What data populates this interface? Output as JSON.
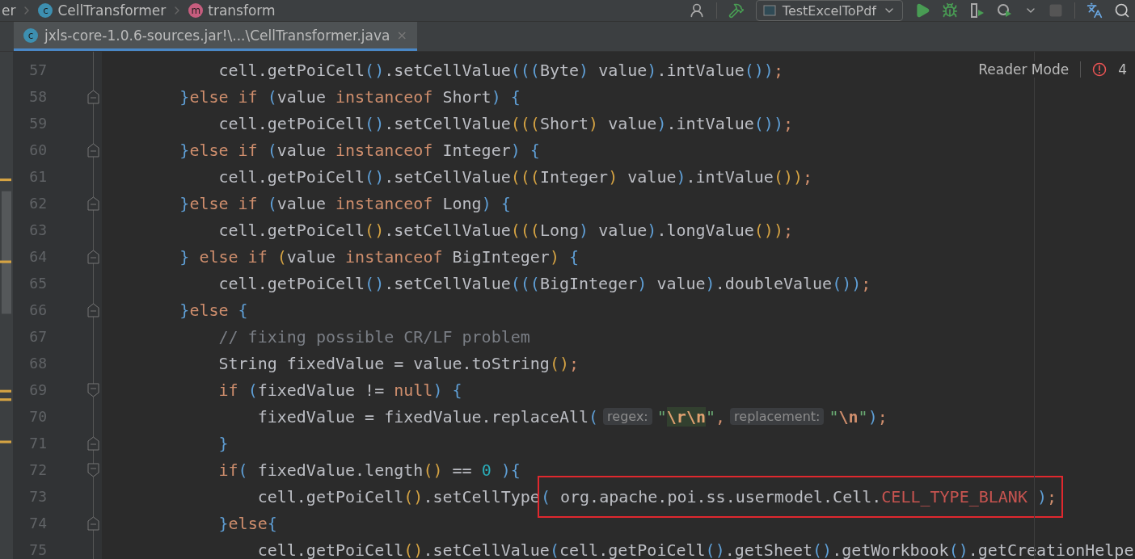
{
  "breadcrumb": [
    {
      "label": "er"
    },
    {
      "label": "CellTransformer",
      "kind": "class",
      "icon_letter": "c"
    },
    {
      "label": "transform",
      "kind": "method",
      "icon_letter": "m"
    }
  ],
  "toolbar": {
    "run_configuration": "TestExcelToPdf"
  },
  "tabs": [
    {
      "label": "jxls-core-1.0.6-sources.jar!\\...\\CellTransformer.java",
      "icon_letter": "c",
      "close": "×",
      "selected": true
    }
  ],
  "editor": {
    "reader_mode": "Reader Mode",
    "error_count": "4",
    "lines": [
      {
        "n": "57",
        "kind": "code",
        "tokens": [
          {
            "t": "            cell.getPoiCell",
            "kind": "plain"
          },
          {
            "t": "()",
            "kind": "paren"
          },
          {
            "t": ".setCellValue",
            "kind": "plain"
          },
          {
            "t": "(((",
            "kind": "paren"
          },
          {
            "t": "Byte",
            "kind": "plain"
          },
          {
            "t": ")",
            "kind": "paren"
          },
          {
            "t": " value",
            "kind": "plain"
          },
          {
            "t": ")",
            "kind": "paren"
          },
          {
            "t": ".intValue",
            "kind": "plain"
          },
          {
            "t": "())",
            "kind": "paren"
          },
          {
            "t": ";",
            "kind": "keyword"
          }
        ]
      },
      {
        "n": "58",
        "kind": "fold-end",
        "tokens": [
          {
            "t": "        }",
            "kind": "paren"
          },
          {
            "t": "else if ",
            "kind": "keyword"
          },
          {
            "t": "(",
            "kind": "paren"
          },
          {
            "t": "value ",
            "kind": "plain"
          },
          {
            "t": "instanceof ",
            "kind": "keyword"
          },
          {
            "t": "Short",
            "kind": "plain"
          },
          {
            "t": ") {",
            "kind": "paren"
          }
        ]
      },
      {
        "n": "59",
        "kind": "code",
        "tokens": [
          {
            "t": "            cell.getPoiCell",
            "kind": "plain"
          },
          {
            "t": "()",
            "kind": "paren"
          },
          {
            "t": ".setCellValue",
            "kind": "plain"
          },
          {
            "t": "(((",
            "kind": "paren2"
          },
          {
            "t": "Short",
            "kind": "plain"
          },
          {
            "t": ")",
            "kind": "paren2"
          },
          {
            "t": " value",
            "kind": "plain"
          },
          {
            "t": ")",
            "kind": "paren"
          },
          {
            "t": ".intValue",
            "kind": "plain"
          },
          {
            "t": "())",
            "kind": "paren"
          },
          {
            "t": ";",
            "kind": "keyword"
          }
        ]
      },
      {
        "n": "60",
        "kind": "fold-end",
        "tokens": [
          {
            "t": "        }",
            "kind": "paren"
          },
          {
            "t": "else if ",
            "kind": "keyword"
          },
          {
            "t": "(",
            "kind": "paren"
          },
          {
            "t": "value ",
            "kind": "plain"
          },
          {
            "t": "instanceof ",
            "kind": "keyword"
          },
          {
            "t": "Integer",
            "kind": "plain"
          },
          {
            "t": ") {",
            "kind": "paren"
          }
        ]
      },
      {
        "n": "61",
        "kind": "code",
        "tokens": [
          {
            "t": "            cell.getPoiCell",
            "kind": "plain"
          },
          {
            "t": "()",
            "kind": "paren"
          },
          {
            "t": ".setCellValue",
            "kind": "plain"
          },
          {
            "t": "(((",
            "kind": "paren2"
          },
          {
            "t": "Integer",
            "kind": "plain"
          },
          {
            "t": ")",
            "kind": "paren2"
          },
          {
            "t": " value",
            "kind": "plain"
          },
          {
            "t": ")",
            "kind": "paren"
          },
          {
            "t": ".intValue",
            "kind": "plain"
          },
          {
            "t": "())",
            "kind": "paren2"
          },
          {
            "t": ";",
            "kind": "keyword"
          }
        ]
      },
      {
        "n": "62",
        "kind": "fold-end",
        "tokens": [
          {
            "t": "        }",
            "kind": "paren"
          },
          {
            "t": "else if ",
            "kind": "keyword"
          },
          {
            "t": "(",
            "kind": "paren"
          },
          {
            "t": "value ",
            "kind": "plain"
          },
          {
            "t": "instanceof ",
            "kind": "keyword"
          },
          {
            "t": "Long",
            "kind": "plain"
          },
          {
            "t": ") {",
            "kind": "paren"
          }
        ]
      },
      {
        "n": "63",
        "kind": "code",
        "tokens": [
          {
            "t": "            cell.getPoiCell",
            "kind": "plain"
          },
          {
            "t": "()",
            "kind": "paren2"
          },
          {
            "t": ".setCellValue",
            "kind": "plain"
          },
          {
            "t": "(((",
            "kind": "paren2"
          },
          {
            "t": "Long",
            "kind": "plain"
          },
          {
            "t": ")",
            "kind": "paren"
          },
          {
            "t": " value",
            "kind": "plain"
          },
          {
            "t": ")",
            "kind": "paren"
          },
          {
            "t": ".longValue",
            "kind": "plain"
          },
          {
            "t": "())",
            "kind": "paren2"
          },
          {
            "t": ";",
            "kind": "keyword"
          }
        ]
      },
      {
        "n": "64",
        "kind": "fold-end",
        "tokens": [
          {
            "t": "        }",
            "kind": "paren"
          },
          {
            "t": " else if ",
            "kind": "keyword"
          },
          {
            "t": "(",
            "kind": "paren2"
          },
          {
            "t": "value ",
            "kind": "plain"
          },
          {
            "t": "instanceof ",
            "kind": "keyword"
          },
          {
            "t": "BigInteger",
            "kind": "plain"
          },
          {
            "t": ")",
            "kind": "paren2"
          },
          {
            "t": " {",
            "kind": "paren"
          }
        ]
      },
      {
        "n": "65",
        "kind": "code",
        "tokens": [
          {
            "t": "            cell.getPoiCell",
            "kind": "plain"
          },
          {
            "t": "()",
            "kind": "paren"
          },
          {
            "t": ".setCellValue",
            "kind": "plain"
          },
          {
            "t": "(((",
            "kind": "paren"
          },
          {
            "t": "BigInteger",
            "kind": "plain"
          },
          {
            "t": ")",
            "kind": "paren"
          },
          {
            "t": " value",
            "kind": "plain"
          },
          {
            "t": ")",
            "kind": "paren"
          },
          {
            "t": ".doubleValue",
            "kind": "plain"
          },
          {
            "t": "())",
            "kind": "paren"
          },
          {
            "t": ";",
            "kind": "keyword"
          }
        ]
      },
      {
        "n": "66",
        "kind": "fold-end",
        "tokens": [
          {
            "t": "        }",
            "kind": "paren"
          },
          {
            "t": "else ",
            "kind": "keyword"
          },
          {
            "t": "{",
            "kind": "paren"
          }
        ]
      },
      {
        "n": "67",
        "kind": "code",
        "tokens": [
          {
            "t": "            // fixing possible CR/LF problem",
            "kind": "comment"
          }
        ]
      },
      {
        "n": "68",
        "kind": "code",
        "tokens": [
          {
            "t": "            String fixedValue = value.toString",
            "kind": "plain"
          },
          {
            "t": "()",
            "kind": "paren2"
          },
          {
            "t": ";",
            "kind": "keyword"
          }
        ]
      },
      {
        "n": "69",
        "kind": "fold-start",
        "tokens": [
          {
            "t": "            if ",
            "kind": "keyword"
          },
          {
            "t": "(",
            "kind": "paren"
          },
          {
            "t": "fixedValue != ",
            "kind": "plain"
          },
          {
            "t": "null",
            "kind": "keyword"
          },
          {
            "t": ") {",
            "kind": "paren"
          }
        ]
      },
      {
        "n": "70",
        "kind": "code",
        "tokens": [
          {
            "t": "                fixedValue = fixedValue.replaceAll",
            "kind": "plain"
          },
          {
            "t": "(",
            "kind": "paren"
          },
          {
            "t": "regex:",
            "kind": "hint"
          },
          {
            "t": "\"",
            "kind": "string"
          },
          {
            "t": "\\r\\n",
            "kind": "escape-match"
          },
          {
            "t": "\"",
            "kind": "string"
          },
          {
            "t": ",",
            "kind": "keyword"
          },
          {
            "t": "replacement:",
            "kind": "hint"
          },
          {
            "t": "\"",
            "kind": "string"
          },
          {
            "t": "\\n",
            "kind": "escape"
          },
          {
            "t": "\"",
            "kind": "string"
          },
          {
            "t": ")",
            "kind": "paren"
          },
          {
            "t": ";",
            "kind": "keyword"
          }
        ]
      },
      {
        "n": "71",
        "kind": "fold-end",
        "tokens": [
          {
            "t": "            }",
            "kind": "paren"
          }
        ]
      },
      {
        "n": "72",
        "kind": "fold-start",
        "tokens": [
          {
            "t": "            if",
            "kind": "keyword"
          },
          {
            "t": "(",
            "kind": "paren"
          },
          {
            "t": " fixedValue.length",
            "kind": "plain"
          },
          {
            "t": "()",
            "kind": "paren2"
          },
          {
            "t": " == ",
            "kind": "plain"
          },
          {
            "t": "0",
            "kind": "number"
          },
          {
            "t": " ){",
            "kind": "paren"
          }
        ]
      },
      {
        "n": "73",
        "kind": "code",
        "tokens": [
          {
            "t": "                cell.getPoiCell",
            "kind": "plain"
          },
          {
            "t": "()",
            "kind": "paren2"
          },
          {
            "t": ".setCellType",
            "kind": "plain"
          }
        ],
        "boxed": [
          {
            "t": "(",
            "kind": "paren"
          },
          {
            "t": " org.apache.poi.ss.usermodel.Cell.",
            "kind": "plain"
          },
          {
            "t": "CELL_TYPE_BLANK",
            "kind": "constant"
          },
          {
            "t": " )",
            "kind": "paren"
          },
          {
            "t": ";",
            "kind": "keyword"
          }
        ]
      },
      {
        "n": "74",
        "kind": "fold-end",
        "tokens": [
          {
            "t": "            }",
            "kind": "paren"
          },
          {
            "t": "else",
            "kind": "keyword"
          },
          {
            "t": "{",
            "kind": "paren"
          }
        ]
      },
      {
        "n": "75",
        "kind": "code",
        "tokens": [
          {
            "t": "                cell.getPoiCell",
            "kind": "plain"
          },
          {
            "t": "()",
            "kind": "paren2"
          },
          {
            "t": ".setCellValue",
            "kind": "plain"
          },
          {
            "t": "(",
            "kind": "paren"
          },
          {
            "t": "cell.getPoiCell",
            "kind": "plain"
          },
          {
            "t": "()",
            "kind": "paren"
          },
          {
            "t": ".getSheet",
            "kind": "plain"
          },
          {
            "t": "()",
            "kind": "paren"
          },
          {
            "t": ".getWorkbook",
            "kind": "plain"
          },
          {
            "t": "()",
            "kind": "paren"
          },
          {
            "t": ".getCreationHelpe",
            "kind": "plain"
          }
        ]
      }
    ]
  }
}
